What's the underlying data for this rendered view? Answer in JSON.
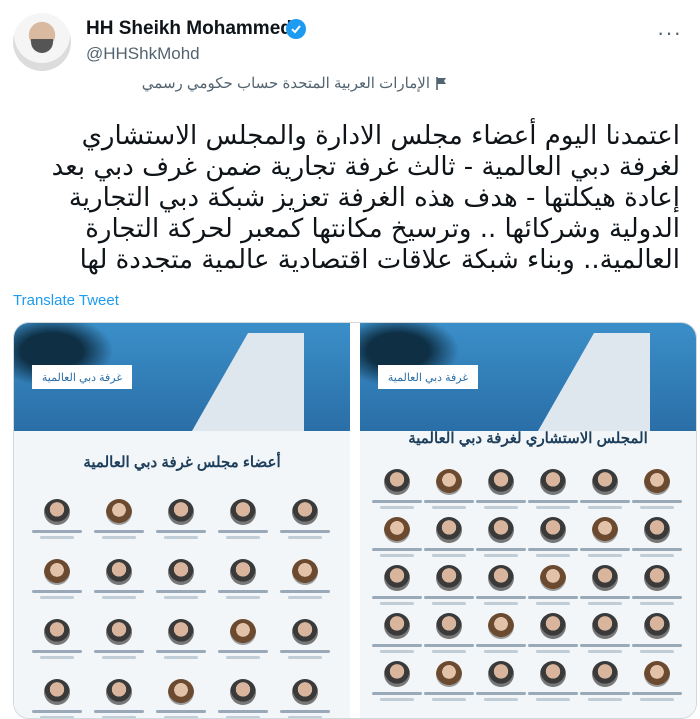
{
  "author": {
    "name": "HH Sheikh Mohammed",
    "handle": "@HHShkMohd",
    "gov_label": "الإمارات العربية المتحدة حساب حكومي رسمي",
    "more_icon": "more-icon",
    "verified_icon": "verified-badge-icon",
    "flag_icon": "flag-icon"
  },
  "tweet": {
    "lines": [
      "اعتمدنا اليوم أعضاء مجلس الادارة والمجلس الاستشاري",
      "لغرفة دبي العالمية - ثالث غرفة تجارية ضمن غرف دبي بعد",
      "إعادة هيكلتها - هدف هذه الغرفة تعزيز شبكة دبي التجارية",
      "الدولية وشركائها .. وترسيخ مكانتها كمعبر لحركة التجارة",
      "العالمية.. وبناء شبكة علاقات اقتصادية عالمية متجددة لها"
    ],
    "translate_label": "Translate Tweet"
  },
  "media": {
    "left": {
      "logo": "غرفة دبي العالمية",
      "title": "أعضاء مجلس غرفة دبي العالمية"
    },
    "right": {
      "logo": "غرفة دبي العالمية",
      "title": "المجلس الاستشاري لغرفة دبي العالمية"
    }
  },
  "colors": {
    "link": "#1d9bf0",
    "muted": "#536471",
    "text": "#0f1419"
  }
}
